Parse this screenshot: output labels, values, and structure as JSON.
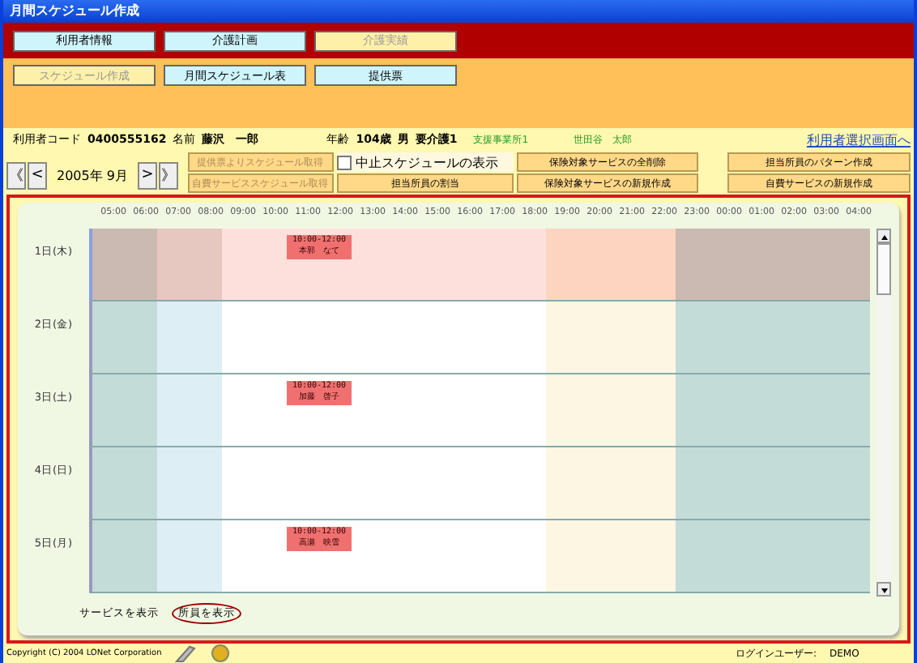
{
  "window": {
    "title": "月間スケジュール作成"
  },
  "main_tabs": [
    {
      "label": "利用者情報",
      "selected": false
    },
    {
      "label": "介護計画",
      "selected": false
    },
    {
      "label": "介護実績",
      "selected": true
    }
  ],
  "sub_tabs": [
    {
      "label": "スケジュール作成",
      "selected": true
    },
    {
      "label": "月間スケジュール表",
      "selected": false
    },
    {
      "label": "提供票",
      "selected": false
    }
  ],
  "client": {
    "code_label": "利用者コード",
    "code": "0400555162",
    "name_label": "名前",
    "name": "藤沢　一郎",
    "age_label": "年齢",
    "age": "104歳",
    "sex": "男",
    "care_level": "要介護1",
    "office": "支援事業所1",
    "manager": "世田谷　太郎",
    "select_link": "利用者選択画面へ"
  },
  "month_nav": {
    "first": "《",
    "prev": "<",
    "month": "2005年 9月",
    "next": ">",
    "last": "》"
  },
  "actions_left": [
    {
      "label": "提供票よりスケジュール取得",
      "disabled": true
    },
    {
      "label": "自費サービススケジュール取得",
      "disabled": true
    }
  ],
  "cancel_checkbox": {
    "label": "中止スケジュールの表示",
    "checked": false
  },
  "actions_right": [
    {
      "label": "保険対象サービスの全削除",
      "disabled": false
    },
    {
      "label": "担当所員のパターン作成",
      "disabled": false
    },
    {
      "label": "担当所員の割当",
      "disabled": false
    },
    {
      "label": "保険対象サービスの新規作成",
      "disabled": false
    },
    {
      "label": "自費サービスの新規作成",
      "disabled": false
    }
  ],
  "schedule": {
    "hours": [
      "05:00",
      "06:00",
      "07:00",
      "08:00",
      "09:00",
      "10:00",
      "11:00",
      "12:00",
      "13:00",
      "14:00",
      "15:00",
      "16:00",
      "17:00",
      "18:00",
      "19:00",
      "20:00",
      "21:00",
      "22:00",
      "23:00",
      "00:00",
      "01:00",
      "02:00",
      "03:00",
      "04:00"
    ],
    "days": [
      {
        "label": "1日(木)",
        "selected": true,
        "events": [
          {
            "time": "10:00-12:00",
            "staff": "本郭　なて"
          }
        ]
      },
      {
        "label": "2日(金)",
        "selected": false
      },
      {
        "label": "3日(土)",
        "selected": false,
        "events": [
          {
            "time": "10:00-12:00",
            "staff": "加藤　啓子"
          }
        ]
      },
      {
        "label": "4日(日)",
        "selected": false
      },
      {
        "label": "5日(月)",
        "selected": false,
        "events": [
          {
            "time": "10:00-12:00",
            "staff": "高瀬　映雪"
          }
        ]
      }
    ]
  },
  "view_toggle": [
    {
      "label": "サービスを表示",
      "selected": false
    },
    {
      "label": "所員を表示",
      "selected": true
    }
  ],
  "status_bar": {
    "copyright": "Copyright (C) 2004 LONet Corporation",
    "login_label": "ログインユーザー:",
    "login_user": "DEMO"
  }
}
